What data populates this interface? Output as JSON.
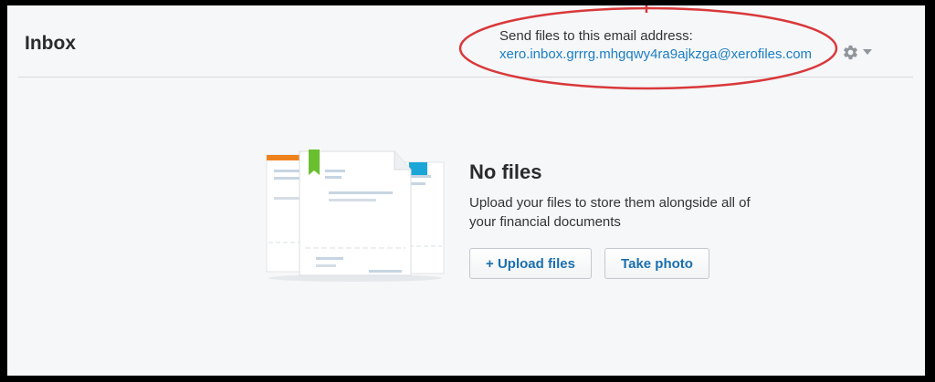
{
  "header": {
    "title": "Inbox",
    "email_label": "Send files to this email address:",
    "email_address": "xero.inbox.grrrg.mhgqwy4ra9ajkzga@xerofiles.com",
    "settings_icon": "gear-icon",
    "dropdown_icon": "caret-down-icon"
  },
  "empty_state": {
    "title": "No files",
    "description": "Upload your files to store them alongside all of your financial documents",
    "upload_button": "+ Upload files",
    "photo_button": "Take photo",
    "illustration": "documents-illustration"
  },
  "colors": {
    "link": "#1b7ec4",
    "annotation": "#d9383a",
    "button_text": "#1b6fae",
    "background": "#f6f7f9",
    "tab_orange": "#f0821e",
    "bookmark_green": "#6abf2e",
    "tab_blue": "#1ba6d8"
  }
}
